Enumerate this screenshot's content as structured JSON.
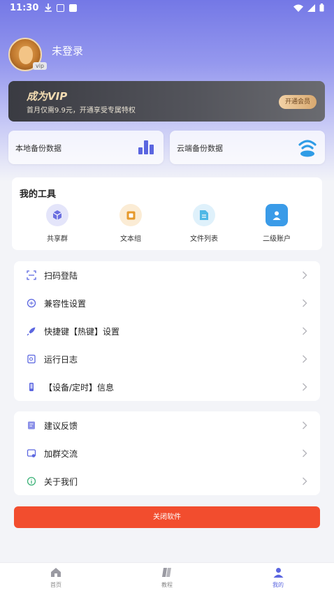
{
  "status_bar": {
    "time": "11:30"
  },
  "profile": {
    "name": "未登录",
    "vip_tag": "vip"
  },
  "vip_banner": {
    "title": "成为VIP",
    "subtitle": "首月仅需9.9元，开通享受专属特权",
    "button": "开通会员"
  },
  "backup": {
    "local": "本地备份数据",
    "cloud": "云端备份数据"
  },
  "tools": {
    "title": "我的工具",
    "items": [
      {
        "label": "共享群",
        "icon": "cube-icon",
        "color": "#6b6fe0"
      },
      {
        "label": "文本组",
        "icon": "document-icon",
        "color": "#e69a2d"
      },
      {
        "label": "文件列表",
        "icon": "file-list-icon",
        "color": "#4fb8e6"
      },
      {
        "label": "二级账户",
        "icon": "user-account-icon",
        "color": "#3a9be8"
      }
    ]
  },
  "menu1": [
    {
      "label": "扫码登陆",
      "icon": "scan-icon"
    },
    {
      "label": "兼容性设置",
      "icon": "compat-icon"
    },
    {
      "label": "快捷键【热键】设置",
      "icon": "rocket-icon"
    },
    {
      "label": "运行日志",
      "icon": "log-icon"
    },
    {
      "label": "【设备/定时】信息",
      "icon": "device-icon"
    }
  ],
  "menu2": [
    {
      "label": "建议反馈",
      "icon": "feedback-icon"
    },
    {
      "label": "加群交流",
      "icon": "group-icon"
    },
    {
      "label": "关于我们",
      "icon": "info-icon"
    }
  ],
  "close_button": "关闭软件",
  "tabs": [
    {
      "label": "首页",
      "icon": "home-icon",
      "active": false
    },
    {
      "label": "教程",
      "icon": "tutorial-icon",
      "active": false
    },
    {
      "label": "我的",
      "icon": "profile-icon",
      "active": true
    }
  ],
  "colors": {
    "accent": "#5b66e0",
    "danger": "#f24d2e",
    "vip_gold": "#f3dcb2"
  }
}
